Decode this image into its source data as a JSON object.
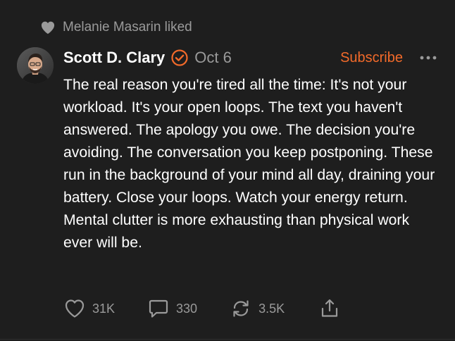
{
  "activity": {
    "icon": "heart-filled-icon",
    "text": "Melanie Masarin liked"
  },
  "post": {
    "author": {
      "name": "Scott D. Clary",
      "avatar": "avatar-photo",
      "verified_icon": "verified-badge-icon"
    },
    "date": "Oct 6",
    "subscribe_label": "Subscribe",
    "more_icon": "more-horizontal-icon",
    "body": "The real reason you're tired all the time: It's not your workload. It's your open loops. The text you haven't answered. The apology you owe. The decision you're avoiding. The conversation you keep postponing. These run in the background of your mind all day, draining your battery. Close your loops. Watch your energy return. Mental clutter is more exhausting than physical work ever will be.",
    "actions": {
      "likes": {
        "icon": "heart-outline-icon",
        "count": "31K"
      },
      "comments": {
        "icon": "comment-icon",
        "count": "330"
      },
      "restacks": {
        "icon": "restack-icon",
        "count": "3.5K"
      },
      "share": {
        "icon": "share-icon"
      }
    }
  },
  "colors": {
    "background": "#1e1e1e",
    "accent": "#f26a2a",
    "muted_text": "#9a9a9a",
    "primary_text": "#ffffff"
  }
}
